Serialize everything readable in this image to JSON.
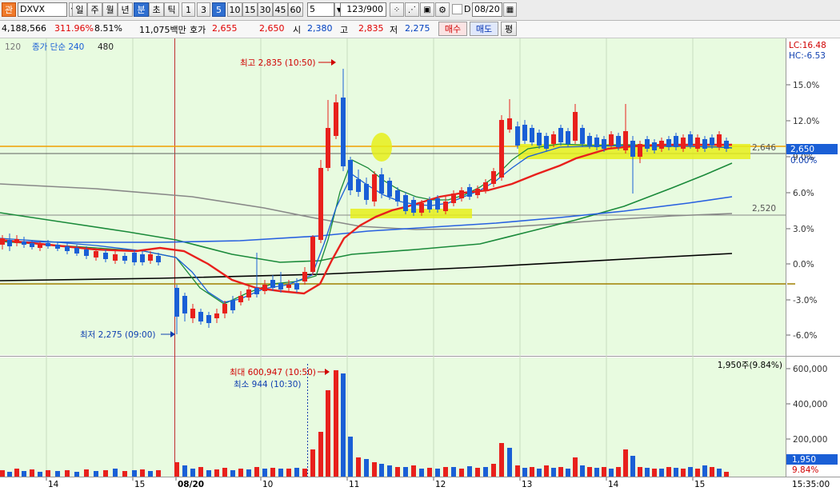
{
  "toolbar": {
    "code_prefix": "관",
    "code": "DXVX",
    "periods": [
      "일",
      "주",
      "월",
      "년",
      "분",
      "초",
      "틱"
    ],
    "active_period": "분",
    "intervals": [
      "1",
      "3",
      "5",
      "10",
      "15",
      "30",
      "45",
      "60"
    ],
    "active_interval": "5",
    "interval_select": "5",
    "count": "123/900",
    "checkbox_label": "D",
    "date": "08/20"
  },
  "info": {
    "volume": "4,188,566",
    "volume_rate": "311.96%",
    "turnover_rate": "8.51%",
    "amount": "11,075백만",
    "quote_label": "호가",
    "ask": "2,655",
    "bid": "2,650",
    "open_label": "시",
    "open": "2,380",
    "high_label": "고",
    "high": "2,835",
    "low_label": "저",
    "low": "2,275",
    "buy_label": "매수",
    "sell_label": "매도",
    "avg_label": "평"
  },
  "legend": {
    "periods": "120",
    "ma_label": "종가 단순 240",
    "extra": "480"
  },
  "annotations": {
    "price_high": "최고 2,835 (10:50)",
    "price_low": "최저 2,275 (09:00)",
    "vol_high": "최대 600,947 (10:50)",
    "vol_low": "최소 944 (10:30)",
    "vol_current": "1,950주(9.84%)",
    "lc": "LC:16.48",
    "hc": "HC:-6.53",
    "level_2646": "2,646",
    "level_2520": "2,520"
  },
  "price_axis": {
    "current_price": "2,650",
    "ticks": [
      "15.0%",
      "12.0%",
      "9.0%",
      "6.0%",
      "3.0%",
      "0.0%",
      "-3.0%",
      "-6.0%"
    ],
    "current_pct": "0.00%"
  },
  "volume_axis": {
    "ticks": [
      "600,000",
      "400,000",
      "200,000"
    ],
    "current": "1,950",
    "current_pct": "9.84%"
  },
  "time_axis": {
    "labels": [
      "14",
      "15",
      "08/20",
      "10",
      "11",
      "12",
      "13",
      "14",
      "15"
    ],
    "clock": "15:35:00"
  },
  "colors": {
    "up": "#e8201c",
    "down": "#1a5fd6",
    "chart_bg": "#e8fbe0",
    "highlight": "#e6ee1a"
  }
}
